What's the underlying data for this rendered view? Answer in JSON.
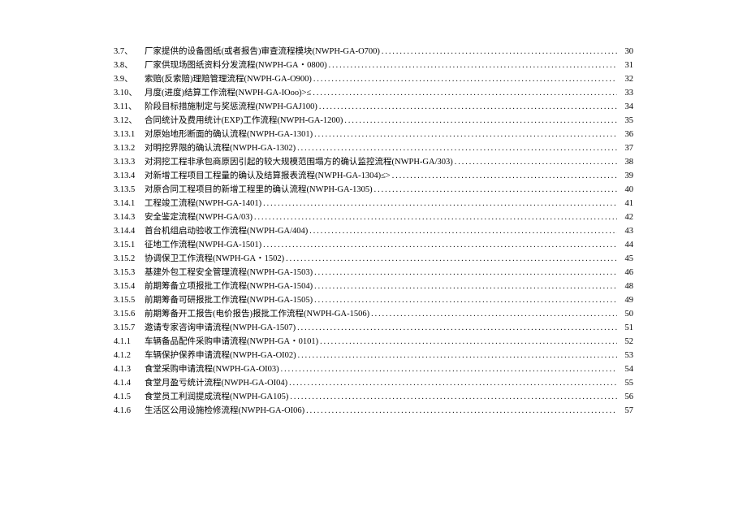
{
  "toc": [
    {
      "number": "3.7、",
      "title": "厂家提供的设备图纸(或者报告)审查流程模块(NWPH-GA-O700)",
      "page": "30"
    },
    {
      "number": "3.8、",
      "title": "厂家供现场图纸资料分发流程(NWPH-GA・0800)",
      "page": "31"
    },
    {
      "number": "3.9、",
      "title": "索赔(反索赔)理赔管理流程(NWPH-GA-O900)",
      "page": "32"
    },
    {
      "number": "3.10、",
      "title": "月度(进度)结算工作流程(NWPH-GA-IOoo)>≤",
      "page": "33"
    },
    {
      "number": "3.11、",
      "title": "阶段目标措施制定与奖惩流程(NWPH-GAJ100)",
      "page": "34"
    },
    {
      "number": "3.12、",
      "title": "合同统计及费用统计(EXP)工作流程(NWPH-GA-1200)",
      "page": "35"
    },
    {
      "number": "3.13.1",
      "title": "对原始地形断面的确认流程(NWPH-GA-1301)",
      "page": "36"
    },
    {
      "number": "3.13.2",
      "title": "对明挖界限的确认流程(NWPH-GA-1302)",
      "page": "37"
    },
    {
      "number": "3.13.3",
      "title": "对洞挖工程非承包商原因引起的较大规模范围塌方的确认监控流程(NWPH-GA/303)",
      "page": "38"
    },
    {
      "number": "3.13.4",
      "title": "对新增工程项目工程量的确认及结算报表流程(NWPH-GA-1304)≤>",
      "page": "39"
    },
    {
      "number": "3.13.5",
      "title": "对原合同工程项目的新增工程里的确认流程(NWPH-GA-1305)",
      "page": "40"
    },
    {
      "number": "3.14.1",
      "title": "工程竣工流程(NWPH-GA-1401)",
      "page": "41"
    },
    {
      "number": "3.14.3",
      "title": "安全鉴定流程(NWPH-GA/03)",
      "page": "42"
    },
    {
      "number": "3.14.4",
      "title": "首台机组启动验收工作流程(NWPH-GA/404)",
      "page": "43"
    },
    {
      "number": "3.15.1",
      "title": "征地工作流程(NWPH-GA-1501)",
      "page": "44"
    },
    {
      "number": "3.15.2",
      "title": "协调保卫工作流程(NWPH-GA・1502)",
      "page": "45"
    },
    {
      "number": "3.15.3",
      "title": "基建外包工程安全管理流程(NWPH-GA-1503)",
      "page": "46"
    },
    {
      "number": "3.15.4",
      "title": "前期筹备立项报批工作流程(NWPH-GA-1504)",
      "page": "48"
    },
    {
      "number": "3.15.5",
      "title": "前期筹备可研报批工作流程(NWPH-GA-1505)",
      "page": "49"
    },
    {
      "number": "3.15.6",
      "title": "前期筹备开工报告(电价报告)报批工作流程(NWPH-GA-1506)",
      "page": "50"
    },
    {
      "number": "3.15.7",
      "title": "邀请专家咨询申请流程(NWPH-GA-1507)",
      "page": "51"
    },
    {
      "number": "4.1.1",
      "title": "车辆备品配件采购申请流程(NWPH-GA・0101)",
      "page": "52"
    },
    {
      "number": "4.1.2",
      "title": "车辆保护保养申请流程(NWPH-GA-OI02)",
      "page": "53"
    },
    {
      "number": "4.1.3",
      "title": "食堂采购申请流程(NWPH-GA-OI03)",
      "page": "54"
    },
    {
      "number": "4.1.4",
      "title": "食堂月盈亏统计流程(NWPH-GA-OI04)",
      "page": "55"
    },
    {
      "number": "4.1.5",
      "title": "食堂员工利润提成流程(NWPH-GA105)",
      "page": "56"
    },
    {
      "number": "4.1.6",
      "title": "生活区公用设施检修流程(NWPH-GA-OI06)",
      "page": "57"
    }
  ]
}
